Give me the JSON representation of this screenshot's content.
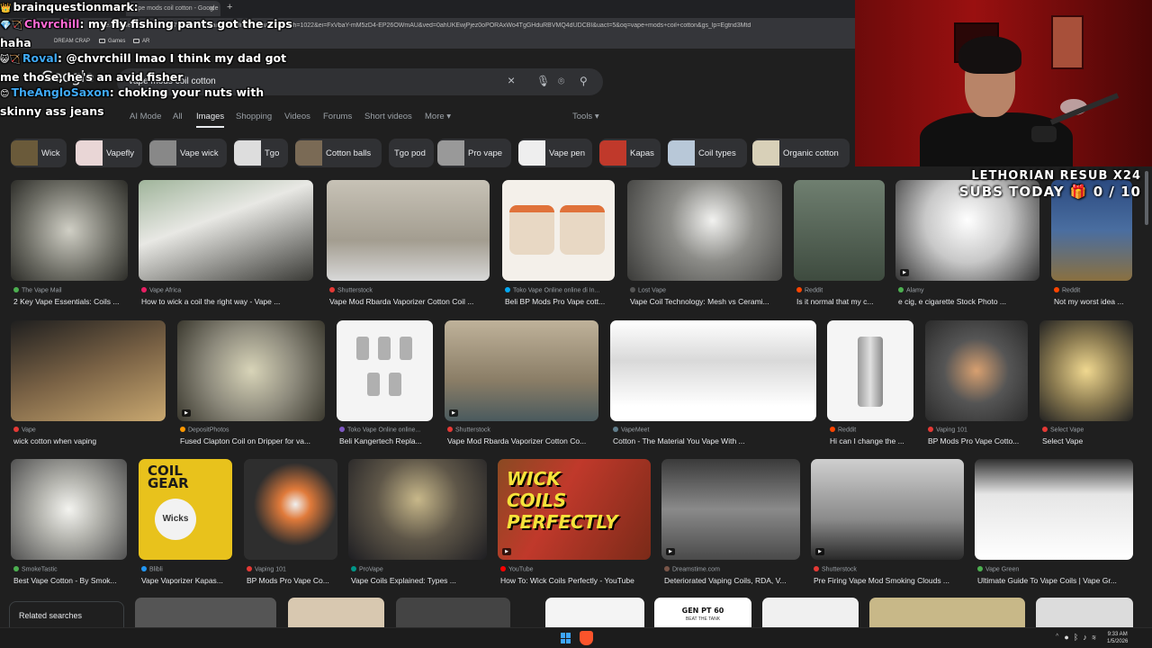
{
  "browser": {
    "tab_title": "vape mods coil cotton - Google",
    "url": "google.com/search?sca_esv=75d7ba9b8a0ac0c1&udm=2&biw=2048&bih=1022&ei=FxVbaY-mM5zD4-EP26OWmAU&ved=0ahUKEwjPjez0oPORAxWo4TgGHduRBVMQ4dUDCBI&uact=5&oq=vape+mods+coil+cotton&gs_lp=Egtnd3Mtd",
    "bookmarks": [
      "DREAM CRAP",
      "Games",
      "AR"
    ]
  },
  "google": {
    "logo": "Google",
    "query": "vape mods coil cotton",
    "nav_tabs": [
      {
        "label": "AI Mode"
      },
      {
        "label": "All"
      },
      {
        "label": "Images"
      },
      {
        "label": "Shopping"
      },
      {
        "label": "Videos"
      },
      {
        "label": "Forums"
      },
      {
        "label": "Short videos"
      },
      {
        "label": "More ▾"
      },
      {
        "label": "Tools ▾"
      }
    ],
    "chips": [
      "Wick",
      "Vapefly",
      "Vape wick",
      "Tgo",
      "Cotton balls",
      "Tgo pod",
      "Pro vape",
      "Vape pen",
      "Kapas",
      "Coil types",
      "Organic cotton"
    ],
    "results": [
      {
        "source": "The Vape Mail",
        "title": "2 Key Vape Essentials: Coils ...",
        "color": "#7a7a72"
      },
      {
        "source": "Vape Africa",
        "title": "How to wick a coil the right way - Vape ...",
        "color": "#8a9a88"
      },
      {
        "source": "Shutterstock",
        "title": "Vape Mod Rbarda Vaporizer Cotton Coil ...",
        "color": "#b9b3a6"
      },
      {
        "source": "Toko Vape Online online di In...",
        "title": "Beli BP Mods Pro Vape cott...",
        "color": "#efe9e0"
      },
      {
        "source": "Lost Vape",
        "title": "Vape Coil Technology: Mesh vs Cerami...",
        "color": "#6e6e6a"
      },
      {
        "source": "Reddit",
        "title": "Is it normal that my c...",
        "color": "#5a6a5c"
      },
      {
        "source": "Alamy",
        "title": "e cig, e cigarette Stock Photo ...",
        "color": "#c8c8c8"
      },
      {
        "source": "Reddit",
        "title": "Not my worst idea ...",
        "color": "#4a6ea0"
      },
      {
        "source": "Vape",
        "title": "wick cotton when vaping",
        "color": "#6f5a40"
      },
      {
        "source": "DepositPhotos",
        "title": "Fused Clapton Coil on Dripper for va...",
        "color": "#8d8a7c"
      },
      {
        "source": "Toko Vape Online online...",
        "title": "Beli Kangertech Repla...",
        "color": "#f2f2f2"
      },
      {
        "source": "Shutterstock",
        "title": "Vape Mod Rbarda Vaporizer Cotton Co...",
        "color": "#a89980"
      },
      {
        "source": "VapeMeet",
        "title": "Cotton - The Material You Vape With ...",
        "color": "#d9d9d9"
      },
      {
        "source": "Reddit",
        "title": "Hi can I change the ...",
        "color": "#f5f5f5"
      },
      {
        "source": "Vaping 101",
        "title": "BP Mods Pro Vape Cotto...",
        "color": "#3a3a3a"
      },
      {
        "source": "Select Vape",
        "title": "Select Vape",
        "color": "#8a7a50"
      },
      {
        "source": "SmokeTastic",
        "title": "Best Vape Cotton - By Smok...",
        "color": "#b3b3ad"
      },
      {
        "source": "Blibli",
        "title": "Vape Vaporizer Kapas...",
        "color": "#e8c21c"
      },
      {
        "source": "Vaping 101",
        "title": "BP Mods Pro Vape Co...",
        "color": "#2e2e2e"
      },
      {
        "source": "ProVape",
        "title": "Vape Coils Explained: Types ...",
        "color": "#5e5648"
      },
      {
        "source": "YouTube",
        "title": "How To: Wick Coils Perfectly - YouTube",
        "color": "#c0392b"
      },
      {
        "source": "Dreamstime.com",
        "title": "Deteriorated Vaping Coils, RDA, V...",
        "color": "#6a6a6a"
      },
      {
        "source": "Shutterstock",
        "title": "Pre Firing Vape Mod Smoking Clouds ...",
        "color": "#8a8a8a"
      },
      {
        "source": "Vape Green",
        "title": "Ultimate Guide To Vape Coils | Vape Gr...",
        "color": "#e6e6e6"
      }
    ],
    "yt_overlay": [
      "WICK",
      "COILS",
      "PERFECTLY"
    ],
    "coil_gear": [
      "COIL",
      "GEAR",
      "Wicks"
    ],
    "related_label": "Related searches",
    "bottom_labels": [
      "GEN PT 60",
      "BEAT THE TANK"
    ]
  },
  "stream": {
    "resub_label": "LETHORIAN RESUB X24",
    "subs_label": "SUBS TODAY 🎁 0 / 10"
  },
  "chat": [
    {
      "badge": "👑",
      "user": "brainquestionmark:",
      "user_color": "#ffffff",
      "text": ""
    },
    {
      "badge": "💎🏹",
      "user": "Chvrchill",
      "user_color": "#ff6ad5",
      "text": ": my fly fishing pants got the zips haha"
    },
    {
      "badge": "😺🏹",
      "user": "Roval",
      "user_color": "#3fa9f5",
      "text": ": @chvrchill lmao I think my dad got me those, he's an avid fisher"
    },
    {
      "badge": "😊",
      "user": "TheAngloSaxon",
      "user_color": "#3fa9f5",
      "text": ": choking your nuts with skinny ass jeans"
    }
  ],
  "taskbar": {
    "time": "9:33 AM",
    "date": "1/5/2026"
  }
}
